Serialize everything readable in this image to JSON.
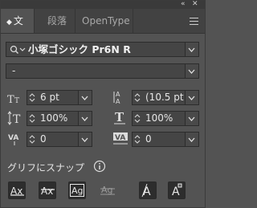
{
  "panel": {
    "tabs": [
      {
        "label": "文字",
        "active": true
      },
      {
        "label": "段落",
        "active": false
      },
      {
        "label": "OpenType",
        "active": false
      }
    ],
    "font_family": "小塚ゴシック Pr6N R",
    "font_style": "-",
    "font_size": "6 pt",
    "leading": "(10.5 pt",
    "vertical_scale": "100%",
    "horizontal_scale": "100%",
    "kerning": "0",
    "tracking": "0",
    "snap_label": "グリフにスナップ",
    "snap_buttons": [
      "baseline-snap",
      "x-height-snap",
      "glyph-bounds-snap",
      "proximity-guides-snap",
      "angular-guides-snap",
      "anchor-point-snap"
    ]
  },
  "colors": {
    "bg": "#535353",
    "field": "#454545",
    "accent_dark": "#2d2d2d"
  }
}
